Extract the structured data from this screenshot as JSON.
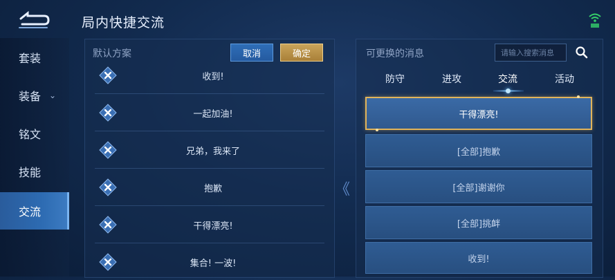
{
  "header": {
    "title": "局内快捷交流"
  },
  "sidebar": {
    "items": [
      {
        "label": "套装"
      },
      {
        "label": "装备",
        "chevron": "⌄"
      },
      {
        "label": "铭文"
      },
      {
        "label": "技能"
      },
      {
        "label": "交流"
      }
    ],
    "active_index": 4
  },
  "left_panel": {
    "title": "默认方案",
    "cancel_label": "取消",
    "confirm_label": "确定",
    "messages": [
      "收到!",
      "一起加油!",
      "兄弟，我来了",
      "抱歉",
      "干得漂亮!",
      "集合! 一波!"
    ]
  },
  "transfer_icon": "《",
  "right_panel": {
    "title": "可更换的消息",
    "search_placeholder": "请输入搜索消息",
    "tabs": [
      "防守",
      "进攻",
      "交流",
      "活动"
    ],
    "active_tab": "交流",
    "options": [
      "干得漂亮!",
      "[全部]抱歉",
      "[全部]谢谢你",
      "[全部]挑衅",
      "收到!"
    ],
    "selected_option": "干得漂亮!"
  },
  "colors": {
    "accent_gold": "#e2b45a",
    "accent_blue": "#2f6eb8",
    "bg_dark": "#0b1d38"
  }
}
